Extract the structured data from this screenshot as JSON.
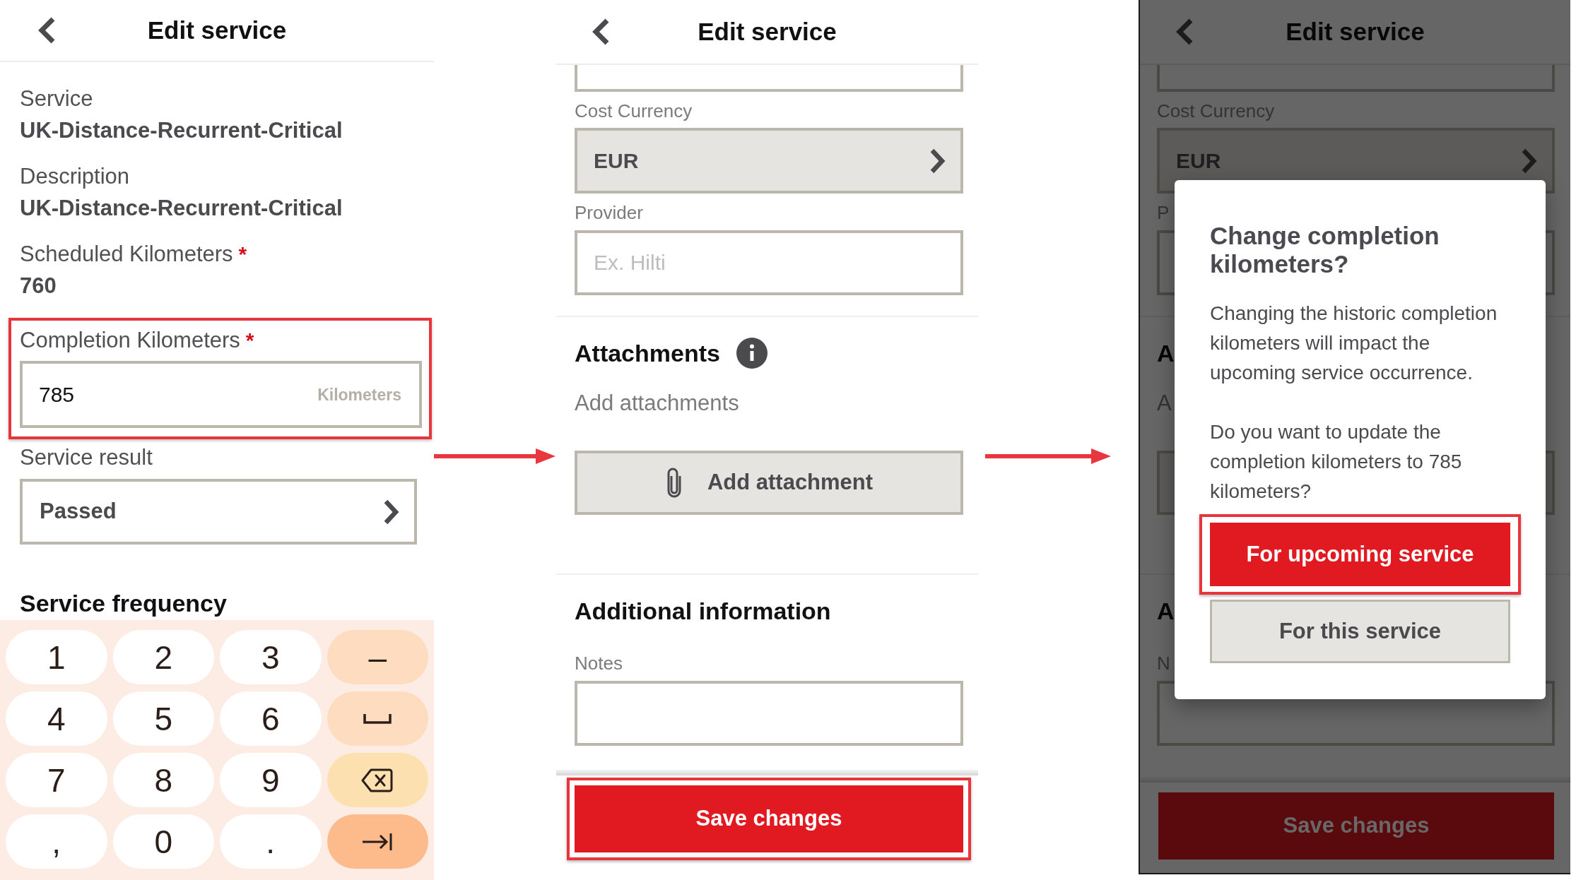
{
  "screens": [
    {
      "kind": "keypad_form",
      "header": {
        "title": "Edit service"
      },
      "fields": [
        {
          "kind": "readonly",
          "label": "Service",
          "value": "UK-Distance-Recurrent-Critical"
        },
        {
          "kind": "readonly",
          "label": "Description",
          "value": "UK-Distance-Recurrent-Critical"
        },
        {
          "kind": "readonly",
          "label": "Scheduled Kilometers",
          "required_mark": "*",
          "value": "760"
        },
        {
          "kind": "input",
          "label": "Completion Kilometers",
          "required_mark": "*",
          "value": "785",
          "unit": "Kilometers",
          "highlighted": true
        },
        {
          "kind": "select",
          "label": "Service result",
          "value": "Passed",
          "highlighted": false
        }
      ],
      "section_title": "Service frequency",
      "keyboard": {
        "keys": [
          {
            "kind": "char",
            "label": "1"
          },
          {
            "kind": "char",
            "label": "2"
          },
          {
            "kind": "char",
            "label": "3"
          },
          {
            "kind": "sign",
            "label": "–"
          },
          {
            "kind": "char",
            "label": "4"
          },
          {
            "kind": "char",
            "label": "5"
          },
          {
            "kind": "char",
            "label": "6"
          },
          {
            "kind": "space"
          },
          {
            "kind": "char",
            "label": "7"
          },
          {
            "kind": "char",
            "label": "8"
          },
          {
            "kind": "char",
            "label": "9"
          },
          {
            "kind": "delete"
          },
          {
            "kind": "char",
            "label": ","
          },
          {
            "kind": "char",
            "label": "0"
          },
          {
            "kind": "char",
            "label": "."
          },
          {
            "kind": "next"
          }
        ]
      }
    },
    {
      "kind": "form",
      "dimmed": false,
      "header": {
        "title": "Edit service"
      },
      "blocks": [
        {
          "kind": "cut_field"
        },
        {
          "kind": "select",
          "label": "Cost Currency",
          "value": "EUR"
        },
        {
          "kind": "input",
          "label": "Provider",
          "placeholder": "Ex. Hilti"
        },
        {
          "kind": "divider"
        },
        {
          "kind": "section",
          "title": "Attachments",
          "info": true
        },
        {
          "kind": "hint",
          "text": "Add attachments"
        },
        {
          "kind": "button",
          "label": "Add attachment"
        },
        {
          "kind": "divider"
        },
        {
          "kind": "section",
          "title": "Additional information"
        },
        {
          "kind": "input",
          "label": "Notes"
        }
      ],
      "save_button": {
        "label": "Save changes",
        "highlighted": true
      }
    },
    {
      "kind": "form",
      "dimmed": true,
      "header": {
        "title": "Edit service"
      },
      "blocks": [
        {
          "kind": "cut_field"
        },
        {
          "kind": "select",
          "label": "Cost Currency",
          "value": "EUR"
        },
        {
          "kind": "input",
          "label": "P",
          "covered": true
        },
        {
          "kind": "divider"
        },
        {
          "kind": "section",
          "title": "A"
        },
        {
          "kind": "hint",
          "text": "A"
        },
        {
          "kind": "button",
          "covered": true
        },
        {
          "kind": "divider"
        },
        {
          "kind": "section",
          "title": "A"
        },
        {
          "kind": "input",
          "label": "N"
        }
      ],
      "save_button": {
        "label": "Save changes",
        "highlighted": false
      },
      "dialog": {
        "title": "Change completion kilometers?",
        "paragraphs": [
          "Changing the historic completion kilometers will impact the upcoming service occurrence.",
          "Do you want to update the completion kilometers to 785 kilometers?"
        ],
        "buttons": [
          {
            "kind": "primary",
            "label": "For upcoming service",
            "highlighted": true
          },
          {
            "kind": "secondary",
            "label": "For this service",
            "highlighted": false
          }
        ]
      }
    }
  ]
}
